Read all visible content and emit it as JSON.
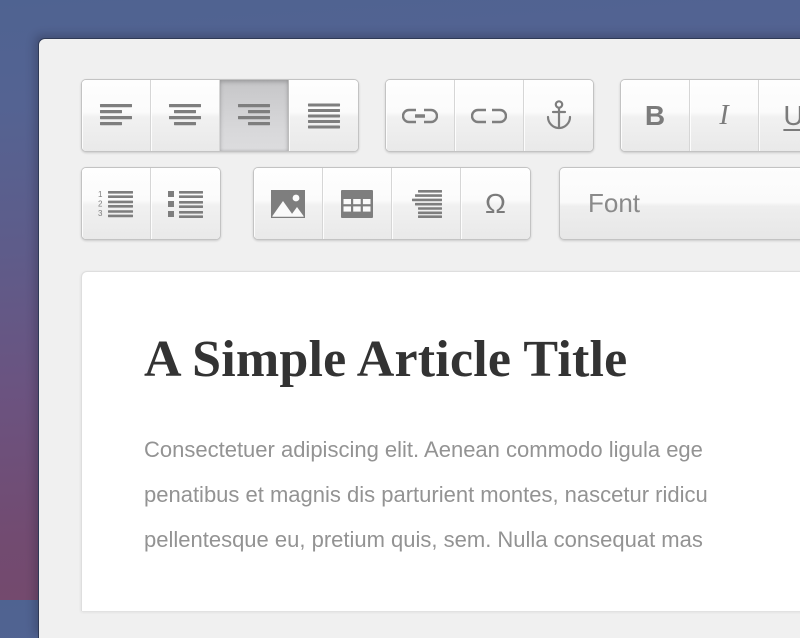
{
  "theme": {
    "background_gradient_top": "#4f6391",
    "background_gradient_bottom": "#75496b",
    "window_background": "#f0f0f0",
    "page_background": "#ffffff",
    "icon_color": "#7e7e7e",
    "body_text_color": "#939393",
    "title_text_color": "#333333"
  },
  "toolbar": {
    "row1": {
      "alignment_group": [
        {
          "name": "align-left",
          "label": "Align Left",
          "active": false
        },
        {
          "name": "align-center",
          "label": "Align Center",
          "active": false
        },
        {
          "name": "align-right",
          "label": "Align Right",
          "active": true
        },
        {
          "name": "align-justify",
          "label": "Justify",
          "active": false
        }
      ],
      "link_group": [
        {
          "name": "link",
          "label": "Insert Link"
        },
        {
          "name": "unlink",
          "label": "Remove Link"
        },
        {
          "name": "anchor",
          "label": "Insert Anchor"
        }
      ],
      "format_group": [
        {
          "name": "bold",
          "label": "B"
        },
        {
          "name": "italic",
          "label": "I"
        },
        {
          "name": "underline",
          "label": "U"
        }
      ]
    },
    "row2": {
      "list_group": [
        {
          "name": "ordered-list",
          "label": "Numbered List"
        },
        {
          "name": "unordered-list",
          "label": "Bulleted List"
        }
      ],
      "insert_group": [
        {
          "name": "image",
          "label": "Insert Image"
        },
        {
          "name": "table",
          "label": "Insert Table"
        },
        {
          "name": "blockquote",
          "label": "Blockquote"
        },
        {
          "name": "special-character",
          "label": "Ω"
        }
      ],
      "font_select": {
        "value": "Font",
        "placeholder": "Font"
      }
    }
  },
  "document": {
    "title": "A Simple Article Title",
    "body_lines": [
      "Consectetuer adipiscing elit. Aenean commodo ligula ege",
      "penatibus et magnis dis parturient montes, nascetur ridicu",
      "pellentesque eu, pretium quis, sem. Nulla consequat mas"
    ]
  }
}
